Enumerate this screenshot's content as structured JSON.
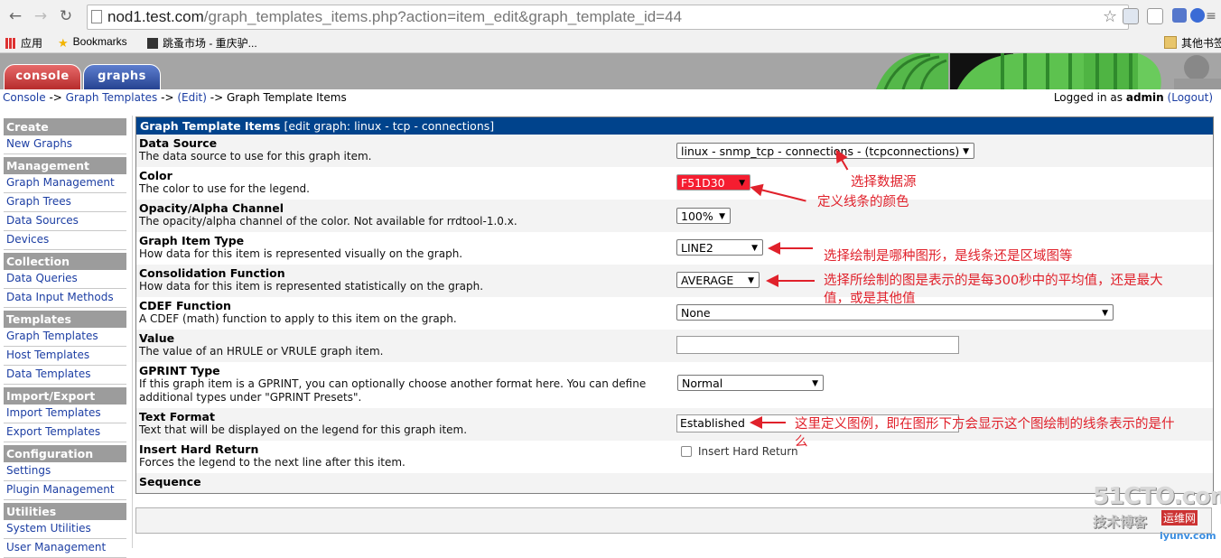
{
  "browser": {
    "url_host": "nod1.test.com",
    "url_rest": "/graph_templates_items.php?action=item_edit&graph_template_id=44",
    "bookmarks": [
      "应用",
      "Bookmarks",
      "跳蚤市场 - 重庆驴...",
      "其他书签"
    ]
  },
  "tabs": {
    "console": "console",
    "graphs": "graphs"
  },
  "breadcrumb": {
    "console": "Console",
    "sep1": " -> ",
    "graph_templates": "Graph Templates",
    "sep2": " -> ",
    "edit": "(Edit)",
    "sep3": " -> ",
    "current": "Graph Template Items"
  },
  "login": {
    "prefix": "Logged in as ",
    "user": "admin",
    "logout": "(Logout)"
  },
  "sidebar": {
    "sections": [
      {
        "title": "Create",
        "items": [
          "New Graphs"
        ]
      },
      {
        "title": "Management",
        "items": [
          "Graph Management",
          "Graph Trees",
          "Data Sources",
          "Devices"
        ]
      },
      {
        "title": "Collection Methods",
        "items": [
          "Data Queries",
          "Data Input Methods"
        ]
      },
      {
        "title": "Templates",
        "items": [
          "Graph Templates",
          "Host Templates",
          "Data Templates"
        ]
      },
      {
        "title": "Import/Export",
        "items": [
          "Import Templates",
          "Export Templates"
        ]
      },
      {
        "title": "Configuration",
        "items": [
          "Settings",
          "Plugin Management"
        ]
      },
      {
        "title": "Utilities",
        "items": [
          "System Utilities",
          "User Management"
        ]
      }
    ]
  },
  "form": {
    "title": "Graph Template Items",
    "subtitle": " [edit graph: linux - tcp - connections]",
    "rows": [
      {
        "label": "Data Source",
        "desc": "The data source to use for this graph item.",
        "value": "linux - snmp_tcp - connections - (tcpconnections)"
      },
      {
        "label": "Color",
        "desc": "The color to use for the legend.",
        "value": "F51D30"
      },
      {
        "label": "Opacity/Alpha Channel",
        "desc": "The opacity/alpha channel of the color. Not available for rrdtool-1.0.x.",
        "value": "100%"
      },
      {
        "label": "Graph Item Type",
        "desc": "How data for this item is represented visually on the graph.",
        "value": "LINE2"
      },
      {
        "label": "Consolidation Function",
        "desc": "How data for this item is represented statistically on the graph.",
        "value": "AVERAGE"
      },
      {
        "label": "CDEF Function",
        "desc": "A CDEF (math) function to apply to this item on the graph.",
        "value": "None"
      },
      {
        "label": "Value",
        "desc": "The value of an HRULE or VRULE graph item.",
        "value": ""
      },
      {
        "label": "GPRINT Type",
        "desc": "If this graph item is a GPRINT, you can optionally choose another format here. You can define additional types under \"GPRINT Presets\".",
        "value": "Normal"
      },
      {
        "label": "Text Format",
        "desc": "Text that will be displayed on the legend for this graph item.",
        "value": "Established"
      },
      {
        "label": "Insert Hard Return",
        "desc": "Forces the legend to the next line after this item.",
        "value": "Insert Hard Return"
      },
      {
        "label": "Sequence",
        "desc": "",
        "value": ""
      }
    ]
  },
  "annotations": {
    "data_source": "选择数据源",
    "color": "定义线条的颜色",
    "item_type": "选择绘制是哪种图形，是线条还是区域图等",
    "cf_line1": "选择所绘制的图是表示的是每300秒中的平均值，还是最大",
    "cf_line2": "值，或是其他值",
    "text_format_line1": "这里定义图例，即在图形下方会显示这个图绘制的线条表示的是什",
    "text_format_line2": "么"
  },
  "watermark": {
    "big": "51CTO.com",
    "small": "技术博客",
    "tag": "运维网",
    "url": "iyunv.com"
  },
  "colors": {
    "accent": "#00438c",
    "line_color": "#e0212b",
    "selected_color": "#F51D30"
  }
}
